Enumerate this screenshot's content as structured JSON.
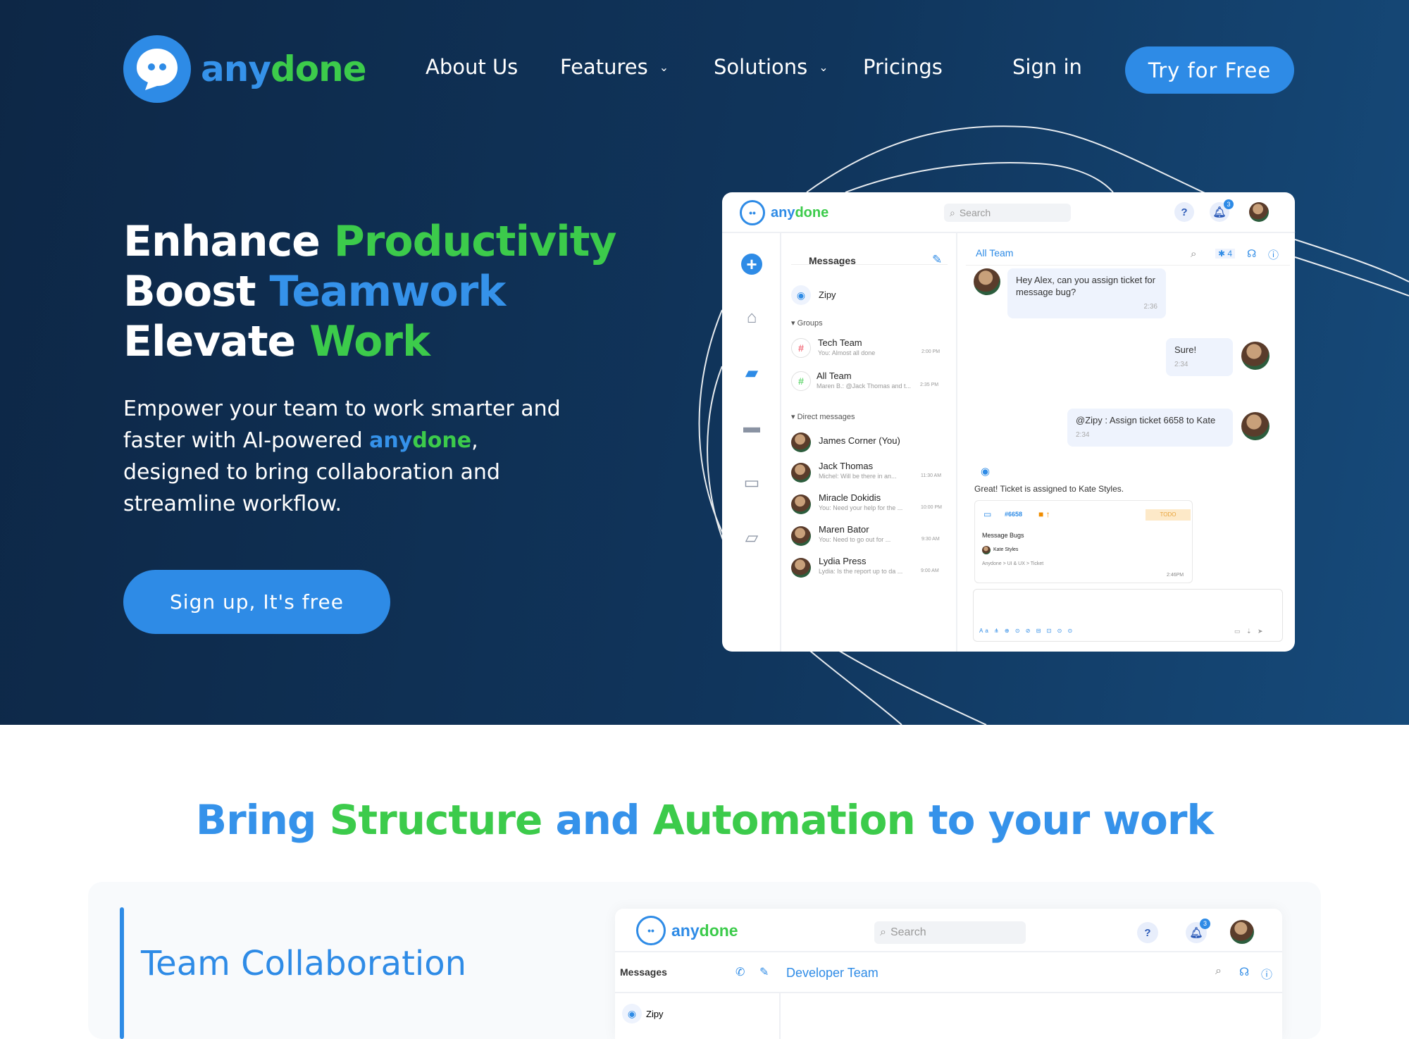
{
  "brand": {
    "part1": "any",
    "part2": "done"
  },
  "nav": {
    "about": "About Us",
    "features": "Features",
    "solutions": "Solutions",
    "pricings": "Pricings",
    "signin": "Sign in",
    "try": "Try for Free"
  },
  "hero": {
    "line1_a": "Enhance ",
    "line1_b": "Productivity",
    "line2_a": "Boost ",
    "line2_b": "Teamwork",
    "line3_a": "Elevate ",
    "line3_b": "Work",
    "sub_a": "Empower your team to work smarter and faster with AI-powered ",
    "sub_brand_a": "any",
    "sub_brand_b": "done",
    "sub_b": ", designed to bring collaboration and streamline workflow.",
    "cta": "Sign up, It's free"
  },
  "app": {
    "search_placeholder": "Search",
    "help": "?",
    "notif_count": "3",
    "messages_title": "Messages",
    "channel_title": "All Team",
    "pin_count": "4",
    "zipy": "Zipy",
    "groups_label": "▾ Groups",
    "groups": [
      {
        "name": "Tech Team",
        "preview": "You: Almost all done",
        "time": "2:00 PM"
      },
      {
        "name": "All Team",
        "preview": "Maren B.: @Jack Thomas and t...",
        "time": "2:35 PM"
      }
    ],
    "dm_label": "▾ Direct messages",
    "dms": [
      {
        "name": "James Corner (You)",
        "preview": "",
        "time": ""
      },
      {
        "name": "Jack Thomas",
        "preview": "Michel: Will be there in an...",
        "time": "11:30 AM"
      },
      {
        "name": "Miracle Dokidis",
        "preview": "You: Need your help for the ...",
        "time": "10:00 PM"
      },
      {
        "name": "Maren Bator",
        "preview": "You: Need to go out for ...",
        "time": "9:30 AM"
      },
      {
        "name": "Lydia Press",
        "preview": "Lydia: Is the report up to da ...",
        "time": "9:00 AM"
      }
    ],
    "msg1": "Hey Alex, can you assign ticket for message bug?",
    "msg1_time": "2:36",
    "msg2": "Sure!",
    "msg2_time": "2:34",
    "msg3": "@Zipy : Assign ticket 6658 to Kate",
    "msg3_time": "2:34",
    "bot_msg": "Great! Ticket is assigned to Kate Styles.",
    "ticket_id": "#6658",
    "ticket_status": "TODO",
    "ticket_title": "Message Bugs",
    "ticket_assignee": "Kate Styles",
    "ticket_path": "Anydone > UI & UX > Ticket",
    "ticket_time": "2:46PM"
  },
  "section2": {
    "t1": "Bring ",
    "t2": "Structure",
    "t3": " and ",
    "t4": "Automation",
    "t5": " to your work",
    "feature": "Team Collaboration",
    "app_messages": "Messages",
    "app_channel": "Developer Team",
    "app_zipy": "Zipy",
    "app_search": "Search",
    "app_help": "?",
    "app_notif": "3"
  },
  "colors": {
    "blue": "#2e8be6",
    "green": "#3ccb4b",
    "navy": "#0d2746"
  }
}
